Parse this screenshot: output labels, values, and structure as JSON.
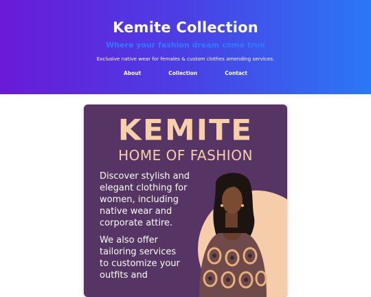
{
  "header": {
    "title": "Kemite Collection",
    "tagline": "Where your fashion dream come true",
    "description": "Exclusive native wear for females & custom clothes amending services.",
    "nav": [
      {
        "label": "About"
      },
      {
        "label": "Collection"
      },
      {
        "label": "Contact"
      }
    ]
  },
  "flyer": {
    "brand": "KEMITE",
    "subtitle": "HOME OF FASHION",
    "text_primary": "Discover stylish and elegant clothing for women, including native wear and corporate attire.",
    "text_secondary": "We also offer tailoring services to customize your outfits and"
  },
  "colors": {
    "hero_start": "#6a1ad8",
    "hero_end": "#2a78f5",
    "tagline": "#2f7bff",
    "flyer_bg": "#563463",
    "flyer_accent": "#f7cfa9"
  }
}
